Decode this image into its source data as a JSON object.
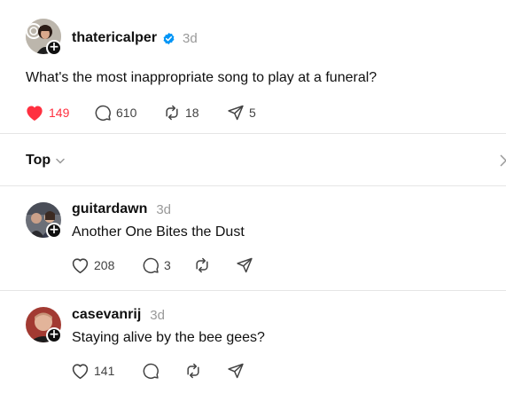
{
  "post": {
    "username": "thatericalper",
    "verified": true,
    "time": "3d",
    "text": "What's the most inappropriate song to play at a funeral?",
    "likes": "149",
    "comments": "610",
    "reposts": "18",
    "shares": "5",
    "liked": true
  },
  "sort": {
    "label": "Top"
  },
  "replies": [
    {
      "username": "guitardawn",
      "time": "3d",
      "text": "Another One Bites the Dust",
      "likes": "208",
      "comments": "3",
      "reposts": "",
      "shares": ""
    },
    {
      "username": "casevanrij",
      "time": "3d",
      "text": "Staying alive by the bee gees?",
      "likes": "141",
      "comments": "",
      "reposts": "",
      "shares": ""
    }
  ],
  "colors": {
    "like": "#ff3040",
    "verified": "#0095f6",
    "muted": "#999999"
  }
}
